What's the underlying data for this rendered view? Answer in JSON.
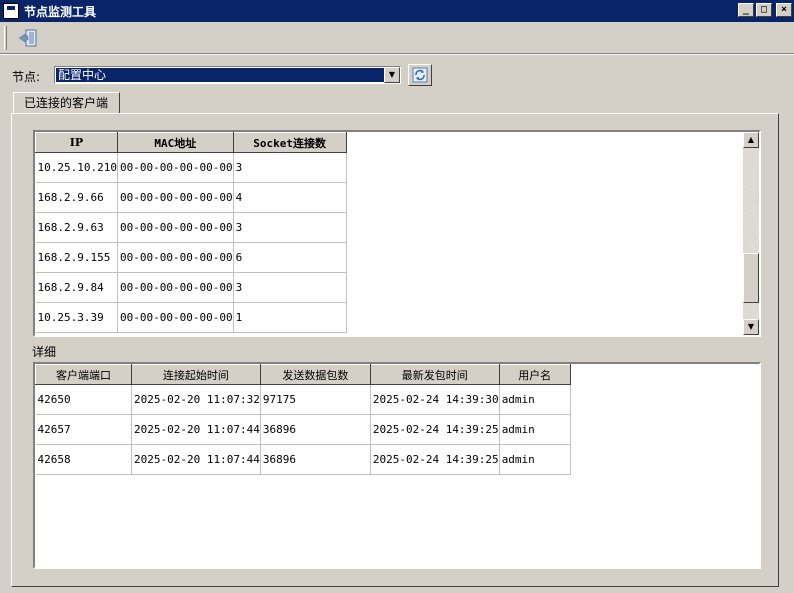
{
  "window": {
    "title": "节点监测工具",
    "min": "_",
    "max": "□",
    "close": "×"
  },
  "node": {
    "label": "节点:",
    "selected": "配置中心"
  },
  "tab": {
    "label": "已连接的客户端"
  },
  "clients": {
    "headers": [
      "IP",
      "MAC地址",
      "Socket连接数"
    ],
    "rows": [
      [
        "10.25.10.210",
        "00-00-00-00-00-00",
        "3"
      ],
      [
        "168.2.9.66",
        "00-00-00-00-00-00",
        "4"
      ],
      [
        "168.2.9.63",
        "00-00-00-00-00-00",
        "3"
      ],
      [
        "168.2.9.155",
        "00-00-00-00-00-00",
        "6"
      ],
      [
        "168.2.9.84",
        "00-00-00-00-00-00",
        "3"
      ],
      [
        "10.25.3.39",
        "00-00-00-00-00-00",
        "1"
      ]
    ]
  },
  "detail": {
    "label": "详细",
    "headers": [
      "客户端端口",
      "连接起始时间",
      "发送数据包数",
      "最新发包时间",
      "用户名"
    ],
    "rows": [
      [
        "42650",
        "2025-02-20 11:07:32",
        "97175",
        "2025-02-24 14:39:30",
        "admin"
      ],
      [
        "42657",
        "2025-02-20 11:07:44",
        "36896",
        "2025-02-24 14:39:25",
        "admin"
      ],
      [
        "42658",
        "2025-02-20 11:07:44",
        "36896",
        "2025-02-24 14:39:25",
        "admin"
      ]
    ]
  }
}
